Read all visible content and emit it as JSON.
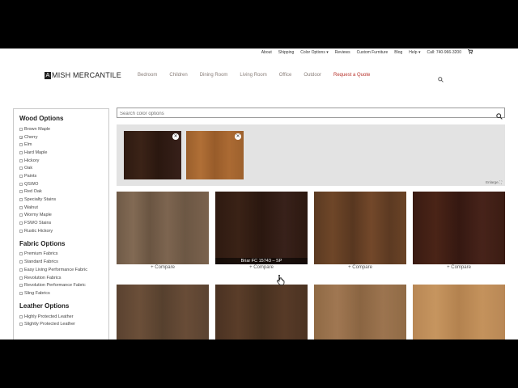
{
  "utility_nav": {
    "about": "About",
    "shipping": "Shipping",
    "color_options": "Color Options ▾",
    "reviews": "Reviews",
    "custom_furniture": "Custom Furniture",
    "blog": "Blog",
    "help": "Help ▾",
    "call": "Call: 740-966-3200"
  },
  "logo": {
    "initial": "A",
    "text": "MISH MERCANTILE"
  },
  "main_nav": {
    "bedroom": "Bedroom",
    "children": "Children",
    "dining_room": "Dining Room",
    "living_room": "Living Room",
    "office": "Office",
    "outdoor": "Outdoor",
    "request_quote": "Request a Quote"
  },
  "sidebar": {
    "wood_heading": "Wood Options",
    "wood_items": [
      {
        "label": "Brown Maple",
        "check": ""
      },
      {
        "label": "Cherry",
        "check": "✓"
      },
      {
        "label": "Elm",
        "check": ""
      },
      {
        "label": "Hard Maple",
        "check": ""
      },
      {
        "label": "Hickory",
        "check": ""
      },
      {
        "label": "Oak",
        "check": ""
      },
      {
        "label": "Paints",
        "check": ""
      },
      {
        "label": "QSWO",
        "check": ""
      },
      {
        "label": "Red Oak",
        "check": ""
      },
      {
        "label": "Specialty Stains",
        "check": ""
      },
      {
        "label": "Walnut",
        "check": ""
      },
      {
        "label": "Wormy Maple",
        "check": ""
      },
      {
        "label": "FSWO Stains",
        "check": ""
      },
      {
        "label": "Rustic Hickory",
        "check": ""
      }
    ],
    "fabric_heading": "Fabric Options",
    "fabric_items": [
      {
        "label": "Premium Fabrics"
      },
      {
        "label": "Standard Fabrics"
      },
      {
        "label": "Easy Living Performance Fabric"
      },
      {
        "label": "Revolution Fabrics"
      },
      {
        "label": "Revolution Performance Fabric"
      },
      {
        "label": "Sling Fabrics"
      }
    ],
    "leather_heading": "Leather Options",
    "leather_items": [
      {
        "label": "Highly Protected Leather"
      },
      {
        "label": "Slightly Protected Leather"
      }
    ]
  },
  "search": {
    "placeholder": "Search color options"
  },
  "compare_panel": {
    "enlarge": "Enlarge ⛶",
    "close": "✕"
  },
  "grid": {
    "compare_label": "+ Compare",
    "hover_label": "Briar FC 15743 – SP"
  }
}
